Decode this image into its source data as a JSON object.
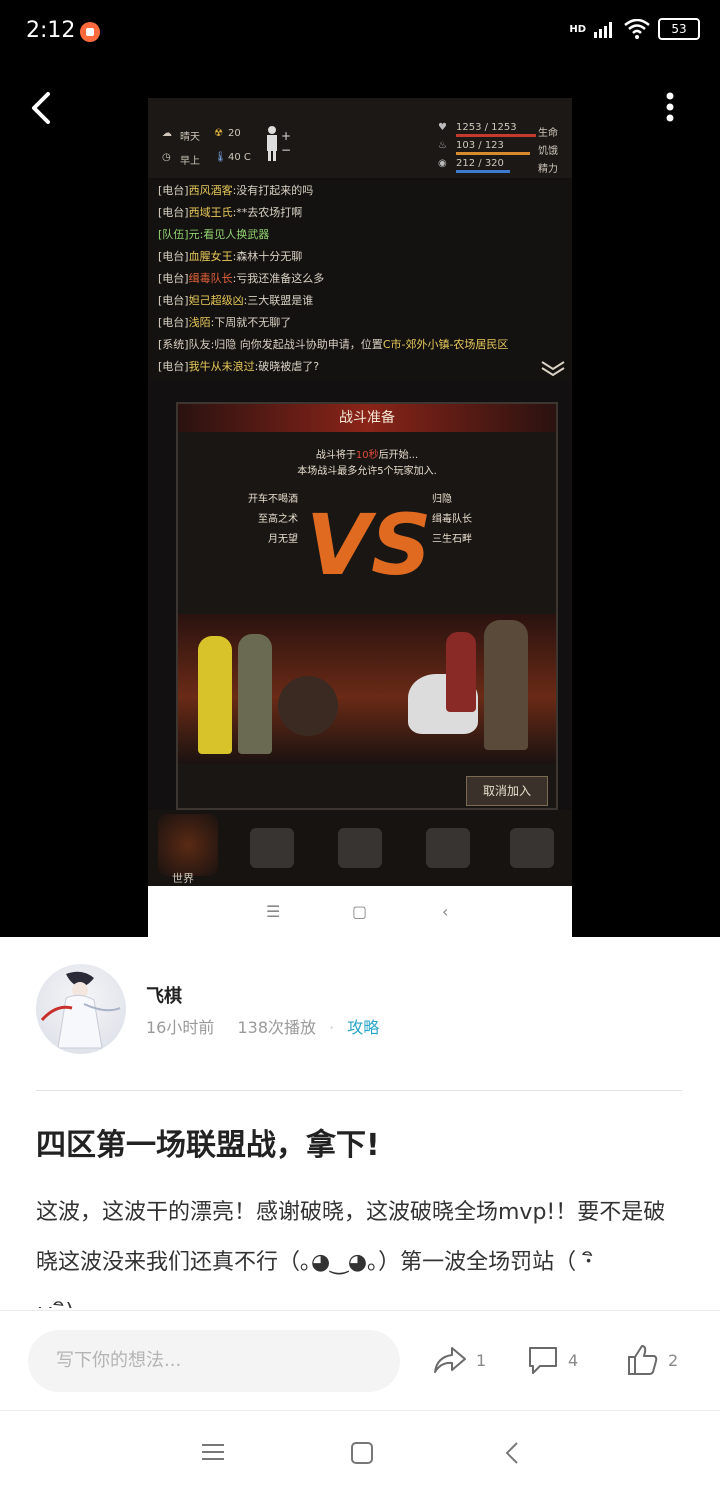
{
  "status_bar": {
    "time": "2:12",
    "network": "HD",
    "battery": "53"
  },
  "game": {
    "hud": {
      "weather": "晴天",
      "radiation": "20",
      "time_of_day": "早上",
      "temperature": "40 C",
      "health_value": "1253 / 1253",
      "health_label": "生命",
      "hunger_value": "103 / 123",
      "hunger_label": "饥饿",
      "spirit_value": "212 / 320",
      "spirit_label": "精力"
    },
    "chat": [
      {
        "channel": "[电台]",
        "name": "西风酒客",
        "text": ":没有打起来的吗"
      },
      {
        "channel": "[电台]",
        "name": "西域王氏",
        "text": ":**去农场打啊"
      },
      {
        "channel": "[队伍]",
        "name": "元",
        "text": ":看见人换武器"
      },
      {
        "channel": "[电台]",
        "name": "血腥女王",
        "text": ":森林十分无聊"
      },
      {
        "channel": "[电台]",
        "name": "缉毒队长",
        "text": ":亏我还准备这么多"
      },
      {
        "channel": "[电台]",
        "name": "妲己超级凶",
        "text": ":三大联盟是谁"
      },
      {
        "channel": "[电台]",
        "name": "浅陌",
        "text": ":下周就不无聊了"
      },
      {
        "channel": "[系统]",
        "name": "队友:归隐",
        "text": " 向你发起战斗协助申请，位置",
        "location": "C市-郊外小镇-农场居民区"
      },
      {
        "channel": "[电台]",
        "name": "我牛从未浪过",
        "text": ":破晓被虐了?"
      }
    ],
    "battle": {
      "title": "战斗准备",
      "start_prefix": "战斗将于",
      "countdown": "10秒",
      "start_suffix": "后开始...",
      "capacity": "本场战斗最多允许5个玩家加入.",
      "vs": "VS",
      "left_team": [
        "开车不喝酒",
        "至高之术",
        "月无望"
      ],
      "right_team": [
        "归隐",
        "缉毒队长",
        "三生石畔"
      ],
      "cancel_label": "取消加入"
    },
    "bottom_nav": {
      "world_label": "世界"
    }
  },
  "author": {
    "name": "飞棋",
    "time_ago": "16小时前",
    "plays": "138次播放",
    "tag": "攻略"
  },
  "post": {
    "title": "四区第一场联盟战，拿下!",
    "body": "这波，这波干的漂亮！感谢破晓，这波破晓全场mvp!！要不是破晓这波没来我们还真不行（｡◕‿◕｡）第一波全场罚站（ ･ิω･ิ)~~~~~"
  },
  "actions": {
    "comment_placeholder": "写下你的想法...",
    "share_count": "1",
    "comment_count": "4",
    "like_count": "2"
  }
}
